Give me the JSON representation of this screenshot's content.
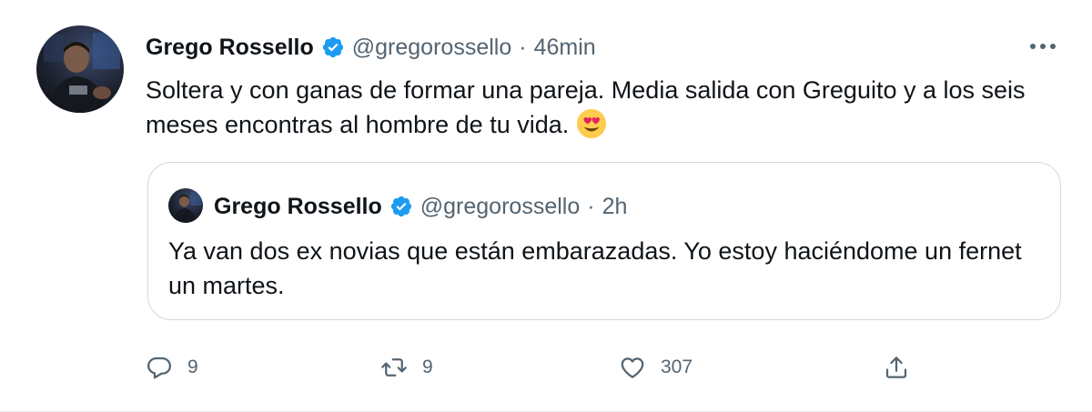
{
  "tweet": {
    "author_name": "Grego Rossello",
    "handle": "@gregorossello",
    "separator": "·",
    "time": "46min",
    "text": "Soltera y con ganas de formar una pareja. Media salida con Greguito y a los seis meses encontras al hombre de tu vida.",
    "emoji": "heart-eyes-emoji",
    "more_icon": "more-horizontal-icon"
  },
  "quoted": {
    "author_name": "Grego Rossello",
    "handle": "@gregorossello",
    "separator": "·",
    "time": "2h",
    "text": "Ya van dos ex novias que están embarazadas. Yo estoy haciéndome un fernet un martes."
  },
  "actions": {
    "reply_count": "9",
    "retweet_count": "9",
    "like_count": "307"
  },
  "colors": {
    "text": "#0f1419",
    "secondary": "#536471",
    "verified": "#1d9bf0",
    "border": "#cfd9de"
  }
}
